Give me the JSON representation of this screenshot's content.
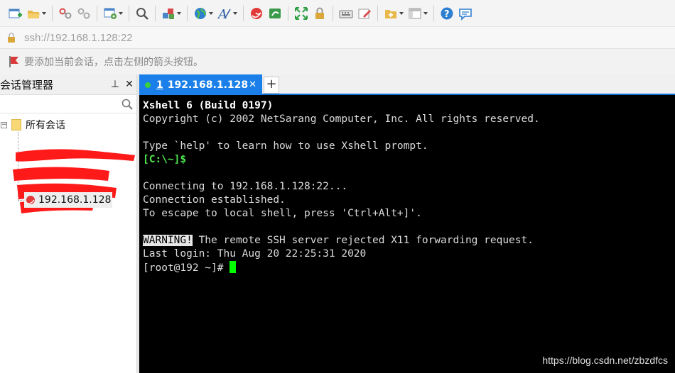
{
  "toolbar": {
    "buttons": [
      {
        "icon": "new-session-icon",
        "dropdown": false
      },
      {
        "icon": "open-folder-icon",
        "dropdown": true
      },
      {
        "icon": "connect-icon",
        "dropdown": false
      },
      {
        "icon": "disconnect-icon",
        "dropdown": false
      },
      {
        "icon": "properties-icon",
        "dropdown": true
      },
      {
        "icon": "search-icon",
        "dropdown": false
      },
      {
        "icon": "transfer-icon",
        "dropdown": true
      },
      {
        "icon": "globe-icon",
        "dropdown": true
      },
      {
        "icon": "font-icon",
        "dropdown": true
      },
      {
        "icon": "xshell-logo-icon",
        "dropdown": false
      },
      {
        "icon": "xftp-icon",
        "dropdown": false
      },
      {
        "icon": "fullscreen-icon",
        "dropdown": false
      },
      {
        "icon": "lock-icon",
        "dropdown": false
      },
      {
        "icon": "keyboard-icon",
        "dropdown": false
      },
      {
        "icon": "compose-icon",
        "dropdown": false
      },
      {
        "icon": "add-folder-icon",
        "dropdown": true
      },
      {
        "icon": "layout-icon",
        "dropdown": true
      },
      {
        "icon": "help-icon",
        "dropdown": false
      },
      {
        "icon": "chat-icon",
        "dropdown": false
      }
    ]
  },
  "address": {
    "value": "ssh://192.168.1.128:22"
  },
  "hint": {
    "text": "要添加当前会话，点击左侧的箭头按钮。"
  },
  "session_panel": {
    "title": "会话管理器",
    "pin_glyph": "⊥",
    "close_glyph": "✕",
    "root": {
      "label": "所有会话",
      "expander": "−"
    },
    "session": {
      "label": "192.168.1.128"
    }
  },
  "tabs": {
    "active": {
      "number": "1",
      "label": "192.168.1.128",
      "close": "✕"
    },
    "add": "+"
  },
  "terminal": {
    "lines": [
      {
        "text": "Xshell 6 (Build 0197)",
        "style": "bold-white"
      },
      {
        "text": "Copyright (c) 2002 NetSarang Computer, Inc. All rights reserved.",
        "style": "normal"
      },
      {
        "text": "",
        "style": "normal"
      },
      {
        "text": "Type `help' to learn how to use Xshell prompt.",
        "style": "normal"
      },
      {
        "text": "[C:\\~]$",
        "style": "green"
      },
      {
        "text": "",
        "style": "normal"
      },
      {
        "text": "Connecting to 192.168.1.128:22...",
        "style": "normal"
      },
      {
        "text": "Connection established.",
        "style": "normal"
      },
      {
        "text": "To escape to local shell, press 'Ctrl+Alt+]'.",
        "style": "normal"
      },
      {
        "text": "",
        "style": "normal"
      }
    ],
    "warning_tag": "WARNING!",
    "warning_text": " The remote SSH server rejected X11 forwarding request.",
    "last_login": "Last login: Thu Aug 20 22:25:31 2020",
    "prompt": "[root@192 ~]# "
  },
  "watermark": "https://blog.csdn.net/zbzdfcs",
  "colors": {
    "accent": "#1a7fe8",
    "terminal_bg": "#000000",
    "cursor": "#00ff00",
    "prompt_green": "#4ee44e"
  }
}
